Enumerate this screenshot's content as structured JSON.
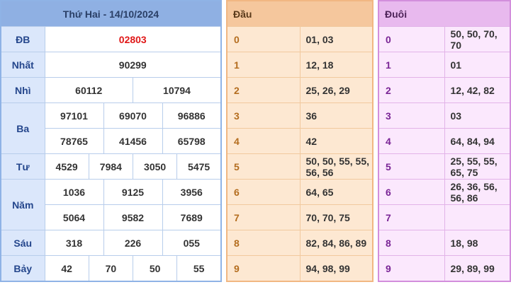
{
  "prize_table": {
    "title": "Thứ Hai - 14/10/2024",
    "rows": [
      {
        "label": "ĐB",
        "values": [
          "02803"
        ]
      },
      {
        "label": "Nhất",
        "values": [
          "90299"
        ]
      },
      {
        "label": "Nhì",
        "values": [
          "60112",
          "10794"
        ]
      },
      {
        "label": "Ba",
        "values": [
          "97101",
          "69070",
          "96886",
          "78765",
          "41456",
          "65798"
        ]
      },
      {
        "label": "Tư",
        "values": [
          "4529",
          "7984",
          "3050",
          "5475"
        ]
      },
      {
        "label": "Năm",
        "values": [
          "1036",
          "9125",
          "3956",
          "5064",
          "9582",
          "7689"
        ]
      },
      {
        "label": "Sáu",
        "values": [
          "318",
          "226",
          "055"
        ]
      },
      {
        "label": "Bảy",
        "values": [
          "42",
          "70",
          "50",
          "55"
        ]
      }
    ]
  },
  "dau_table": {
    "header": "Đầu",
    "rows": [
      {
        "key": "0",
        "value": "01, 03"
      },
      {
        "key": "1",
        "value": "12, 18"
      },
      {
        "key": "2",
        "value": "25, 26, 29"
      },
      {
        "key": "3",
        "value": "36"
      },
      {
        "key": "4",
        "value": "42"
      },
      {
        "key": "5",
        "value": "50, 50, 55, 55, 56, 56"
      },
      {
        "key": "6",
        "value": "64, 65"
      },
      {
        "key": "7",
        "value": "70, 70, 75"
      },
      {
        "key": "8",
        "value": "82, 84, 86, 89"
      },
      {
        "key": "9",
        "value": "94, 98, 99"
      }
    ]
  },
  "duoi_table": {
    "header": "Đuôi",
    "rows": [
      {
        "key": "0",
        "value": "50, 50, 70, 70"
      },
      {
        "key": "1",
        "value": "01"
      },
      {
        "key": "2",
        "value": "12, 42, 82"
      },
      {
        "key": "3",
        "value": "03"
      },
      {
        "key": "4",
        "value": "64, 84, 94"
      },
      {
        "key": "5",
        "value": "25, 55, 55, 65, 75"
      },
      {
        "key": "6",
        "value": "26, 36, 56, 56, 86"
      },
      {
        "key": "7",
        "value": ""
      },
      {
        "key": "8",
        "value": "18, 98"
      },
      {
        "key": "9",
        "value": "29, 89, 99"
      }
    ]
  },
  "colors": {
    "special_prize": "#e01818",
    "prize_header": "#8fb0e3",
    "dau_header": "#f5c79d",
    "duoi_header": "#e8b9ee"
  }
}
